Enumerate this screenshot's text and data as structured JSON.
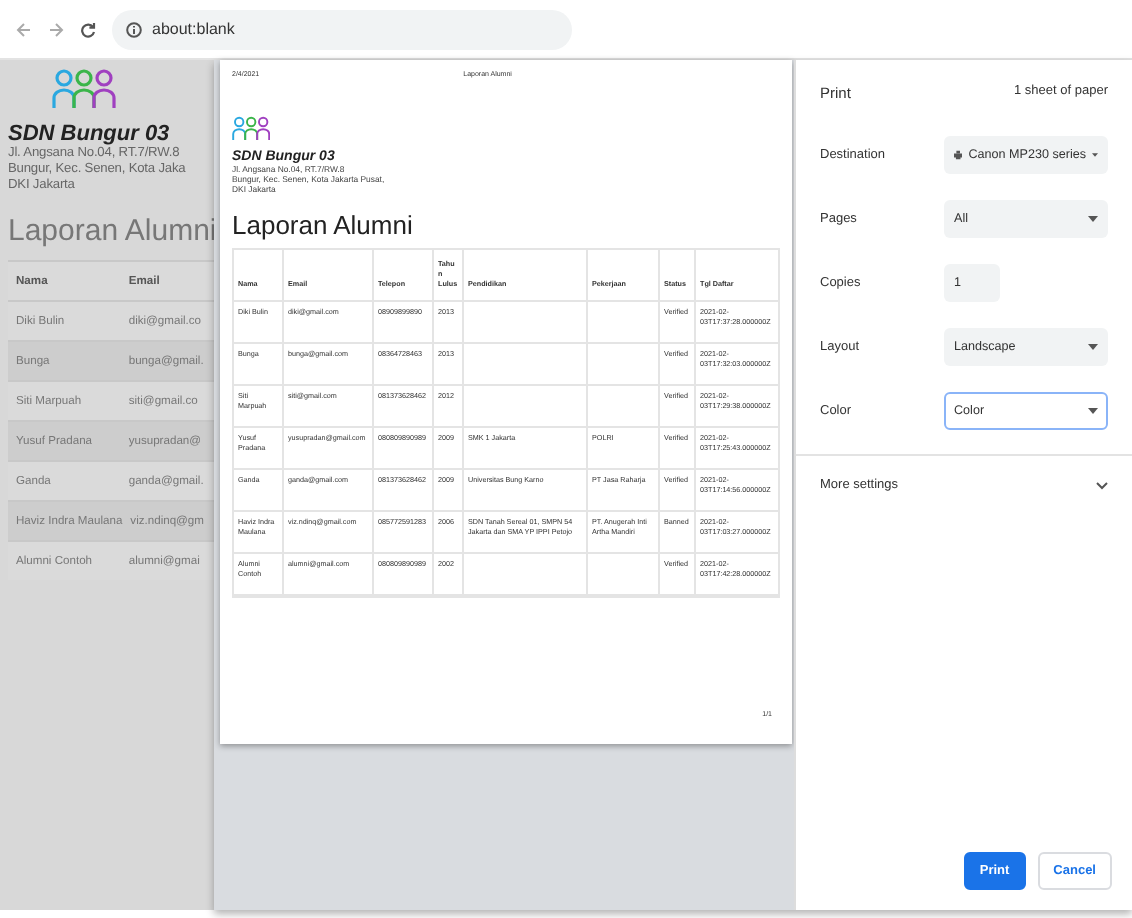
{
  "browser": {
    "url": "about:blank"
  },
  "page": {
    "school": "SDN Bungur 03",
    "address": [
      "Jl. Angsana No.04, RT.7/RW.8",
      "Bungur, Kec. Senen, Kota Jaka",
      "DKI Jakarta"
    ],
    "title": "Laporan Alumni",
    "columns": [
      "Nama",
      "Email"
    ],
    "rows": [
      [
        "Diki Bulin",
        "diki@gmail.co"
      ],
      [
        "Bunga",
        "bunga@gmail."
      ],
      [
        "Siti Marpuah",
        "siti@gmail.co"
      ],
      [
        "Yusuf Pradana",
        "yusupradan@"
      ],
      [
        "Ganda",
        "ganda@gmail."
      ],
      [
        "Haviz Indra Maulana",
        "viz.ndinq@gm"
      ],
      [
        "Alumni Contoh",
        "alumni@gmai"
      ]
    ]
  },
  "preview": {
    "date": "2/4/2021",
    "header_title": "Laporan Alumni",
    "school": "SDN Bungur 03",
    "address": [
      "Jl. Angsana No.04, RT.7/RW.8",
      "Bungur, Kec. Senen, Kota Jakarta Pusat,",
      "DKI Jakarta"
    ],
    "title": "Laporan Alumni",
    "columns": [
      "Nama",
      "Email",
      "Telepon",
      "Tahun Lulus",
      "Pendidikan",
      "Pekerjaan",
      "Status",
      "Tgl Daftar"
    ],
    "rows": [
      [
        "Diki Bulin",
        "diki@gmail.com",
        "08909899890",
        "2013",
        "",
        "",
        "Verified",
        "2021-02-03T17:37:28.000000Z"
      ],
      [
        "Bunga",
        "bunga@gmail.com",
        "08364728463",
        "2013",
        "",
        "",
        "Verified",
        "2021-02-03T17:32:03.000000Z"
      ],
      [
        "Siti Marpuah",
        "siti@gmail.com",
        "081373628462",
        "2012",
        "",
        "",
        "Verified",
        "2021-02-03T17:29:38.000000Z"
      ],
      [
        "Yusuf Pradana",
        "yusupradan@gmail.com",
        "080809890989",
        "2009",
        "SMK 1 Jakarta",
        "POLRI",
        "Verified",
        "2021-02-03T17:25:43.000000Z"
      ],
      [
        "Ganda",
        "ganda@gmail.com",
        "081373628462",
        "2009",
        "Universitas Bung Karno",
        "PT Jasa Raharja",
        "Verified",
        "2021-02-03T17:14:56.000000Z"
      ],
      [
        "Haviz Indra Maulana",
        "viz.ndinq@gmail.com",
        "085772591283",
        "2006",
        "SDN Tanah Sereal 01, SMPN 54 Jakarta dan SMA YP IPPI Petojo",
        "PT. Anugerah Inti Artha Mandiri",
        "Banned",
        "2021-02-03T17:03:27.000000Z"
      ],
      [
        "Alumni Contoh",
        "alumni@gmail.com",
        "080809890989",
        "2002",
        "",
        "",
        "Verified",
        "2021-02-03T17:42:28.000000Z"
      ]
    ],
    "page_number": "1/1"
  },
  "print_panel": {
    "title": "Print",
    "sheets": "1 sheet of paper",
    "settings": [
      {
        "label": "Destination",
        "kind": "printer",
        "value": "Canon MP230 series",
        "focused": false
      },
      {
        "label": "Pages",
        "kind": "select",
        "value": "All",
        "focused": false
      },
      {
        "label": "Copies",
        "kind": "input",
        "value": "1",
        "focused": false
      },
      {
        "label": "Layout",
        "kind": "select",
        "value": "Landscape",
        "focused": false
      },
      {
        "label": "Color",
        "kind": "select",
        "value": "Color",
        "focused": true
      }
    ],
    "more_settings": {
      "label": "More settings",
      "expanded": false
    },
    "buttons": [
      {
        "label": "Print",
        "kind": "primary"
      },
      {
        "label": "Cancel",
        "kind": "secondary"
      }
    ]
  }
}
